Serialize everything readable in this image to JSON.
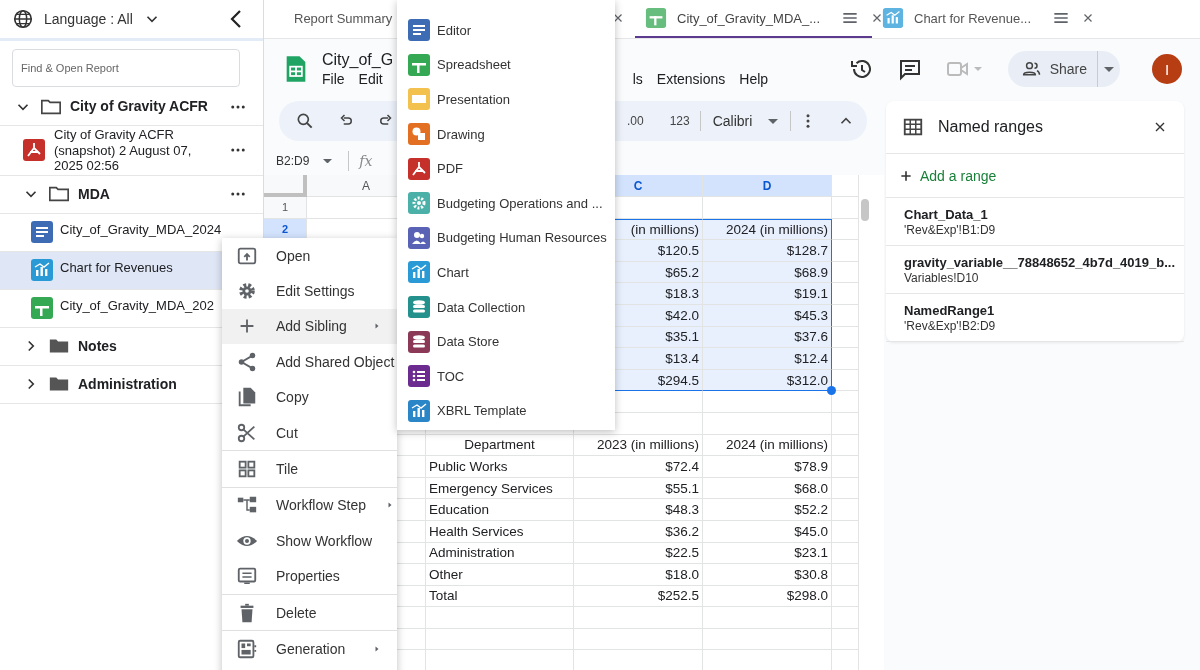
{
  "sidebar": {
    "language": "Language : All",
    "search": {
      "placeholder": "Find & Open Report"
    },
    "tree": [
      {
        "label": "City of Gravity ACFR",
        "kind": "folder",
        "expanded": true,
        "selected": false,
        "more": true,
        "children": [
          {
            "label": "City of Gravity ACFR (snapshot) 2 August 07, 2025 02:56",
            "kind": "pdf",
            "selected": false,
            "more": true
          },
          {
            "label": "MDA",
            "kind": "folder",
            "expanded": true,
            "selected": false,
            "more": true,
            "children": [
              {
                "label": "City_of_Gravity_MDA_2024",
                "kind": "doc",
                "selected": false,
                "more": false
              },
              {
                "label": "Chart for Revenues",
                "kind": "chart",
                "selected": true,
                "more": false
              },
              {
                "label": "City_of_Gravity_MDA_202",
                "kind": "sheet",
                "selected": false,
                "more": false
              }
            ]
          },
          {
            "label": "Notes",
            "kind": "folder",
            "expanded": false,
            "selected": false,
            "more": false
          },
          {
            "label": "Administration",
            "kind": "folder",
            "expanded": false,
            "selected": false,
            "more": false
          }
        ]
      }
    ]
  },
  "tabs": [
    {
      "label": "Report Summary",
      "kind": "plain",
      "selected": false
    },
    {
      "label": "City_of_Gravity_MDA_...",
      "kind": "sheet",
      "selected": true
    },
    {
      "label": "Chart for Revenue...",
      "kind": "chart",
      "selected": false
    }
  ],
  "document": {
    "title": "City_of_G",
    "menus": [
      "File",
      "Edit",
      "ls",
      "Extensions",
      "Help"
    ],
    "share": "Share",
    "avatar": "I"
  },
  "toolbar": {
    "decimal": ".00",
    "number_format": "123",
    "font": "Calibri"
  },
  "formula_bar": {
    "name_box": "B2:D9",
    "fx": "fx"
  },
  "sheet": {
    "columns": [
      {
        "label": "A",
        "selected": false
      },
      {
        "label": "C",
        "selected": true
      },
      {
        "label": "D",
        "selected": true
      }
    ],
    "rows": [
      {
        "number": "1",
        "selected": false
      },
      {
        "number": "2",
        "selected": true,
        "col_c": "(in millions)",
        "col_d": "2024 (in millions)"
      },
      {
        "selected": true,
        "col_c": "$120.5",
        "col_d": "$128.7"
      },
      {
        "selected": true,
        "col_c": "$65.2",
        "col_d": "$68.9"
      },
      {
        "selected": true,
        "col_c": "$18.3",
        "col_d": "$19.1"
      },
      {
        "selected": true,
        "col_c": "$42.0",
        "col_d": "$45.3"
      },
      {
        "selected": true,
        "col_c": "$35.1",
        "col_d": "$37.6"
      },
      {
        "selected": true,
        "col_c": "$13.4",
        "col_d": "$12.4"
      },
      {
        "selected": true,
        "col_c": "$294.5",
        "col_d": "$312.0"
      }
    ],
    "second_table": [
      {
        "kind": "header",
        "col_b": "Department",
        "col_c": "2023 (in millions)",
        "col_d": "2024 (in millions)"
      },
      {
        "col_b": "Public Works",
        "col_c": "$72.4",
        "col_d": "$78.9"
      },
      {
        "col_b": "Emergency Services",
        "col_c": "$55.1",
        "col_d": "$68.0"
      },
      {
        "col_b": "Education",
        "col_c": "$48.3",
        "col_d": "$52.2"
      },
      {
        "col_b": "Health Services",
        "col_c": "$36.2",
        "col_d": "$45.0"
      },
      {
        "col_b": "Administration",
        "col_c": "$22.5",
        "col_d": "$23.1"
      },
      {
        "col_b": "Other",
        "col_c": "$18.0",
        "col_d": "$30.8"
      },
      {
        "col_b": "Total",
        "col_c": "$252.5",
        "col_d": "$298.0"
      }
    ]
  },
  "named_ranges": {
    "title": "Named ranges",
    "add": "Add a range",
    "items": [
      {
        "name": "Chart_Data_1",
        "range": "'Rev&Exp'!B1:D9"
      },
      {
        "name": "gravity_variable__78848652_4b7d_4019_b...",
        "range": "Variables!D10"
      },
      {
        "name": "NamedRange1",
        "range": "'Rev&Exp'!B2:D9"
      }
    ]
  },
  "context_menu": {
    "groups": [
      [
        {
          "label": "Open",
          "submenu": false,
          "selected": false
        },
        {
          "label": "Edit Settings",
          "submenu": false,
          "selected": false
        },
        {
          "label": "Add Sibling",
          "submenu": true,
          "selected": true
        },
        {
          "label": "Add Shared Object",
          "submenu": false,
          "selected": false
        },
        {
          "label": "Copy",
          "submenu": false,
          "selected": false
        },
        {
          "label": "Cut",
          "submenu": false,
          "selected": false
        }
      ],
      [
        {
          "label": "Tile",
          "submenu": false,
          "selected": false
        }
      ],
      [
        {
          "label": "Workflow Step",
          "submenu": true,
          "selected": false
        },
        {
          "label": "Show Workflow",
          "submenu": false,
          "selected": false
        },
        {
          "label": "Properties",
          "submenu": false,
          "selected": false
        }
      ],
      [
        {
          "label": "Delete",
          "submenu": false,
          "selected": false
        }
      ],
      [
        {
          "label": "Generation",
          "submenu": true,
          "selected": false
        }
      ]
    ]
  },
  "submenu": {
    "items": [
      {
        "label": "Editor",
        "kind": "doc"
      },
      {
        "label": "Spreadsheet",
        "kind": "sheet"
      },
      {
        "label": "Presentation",
        "kind": "slides"
      },
      {
        "label": "Drawing",
        "kind": "drawing"
      },
      {
        "label": "PDF",
        "kind": "pdf"
      },
      {
        "label": "Budgeting Operations and ...",
        "kind": "ops"
      },
      {
        "label": "Budgeting Human Resources",
        "kind": "hr"
      },
      {
        "label": "Chart",
        "kind": "chart"
      },
      {
        "label": "Data Collection",
        "kind": "dbc"
      },
      {
        "label": "Data Store",
        "kind": "dbs"
      },
      {
        "label": "TOC",
        "kind": "toc"
      },
      {
        "label": "XBRL Template",
        "kind": "xbrl"
      }
    ]
  }
}
